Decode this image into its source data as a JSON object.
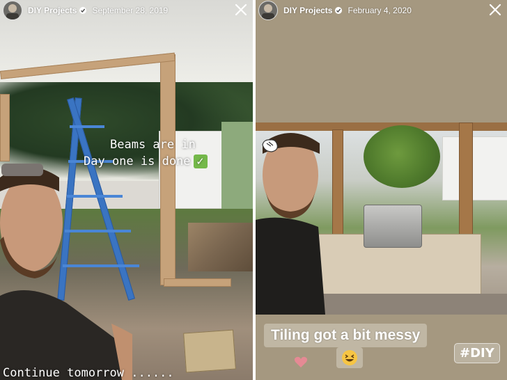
{
  "left_story": {
    "account_name": "DIY Projects",
    "date": "September 28, 2019",
    "caption_line1": "Beams are in",
    "caption_line2": "Day one is done",
    "caption_bottom": "Continue tomorrow ......"
  },
  "right_story": {
    "account_name": "DIY Projects",
    "date": "February 4, 2020",
    "caption": "Tiling got a bit messy",
    "hashtag": "#DIY"
  },
  "icons": {
    "close": "close-icon",
    "verified": "verified-badge-icon",
    "checkmark": "check-mark-emoji",
    "emoji": "grinning-squinting-face-emoji",
    "heart": "heart-icon",
    "sticker": "hand-sticker-icon"
  },
  "colors": {
    "header_text": "#ffffff",
    "check_green": "#74b84a",
    "heart_pink": "#e58a94"
  }
}
